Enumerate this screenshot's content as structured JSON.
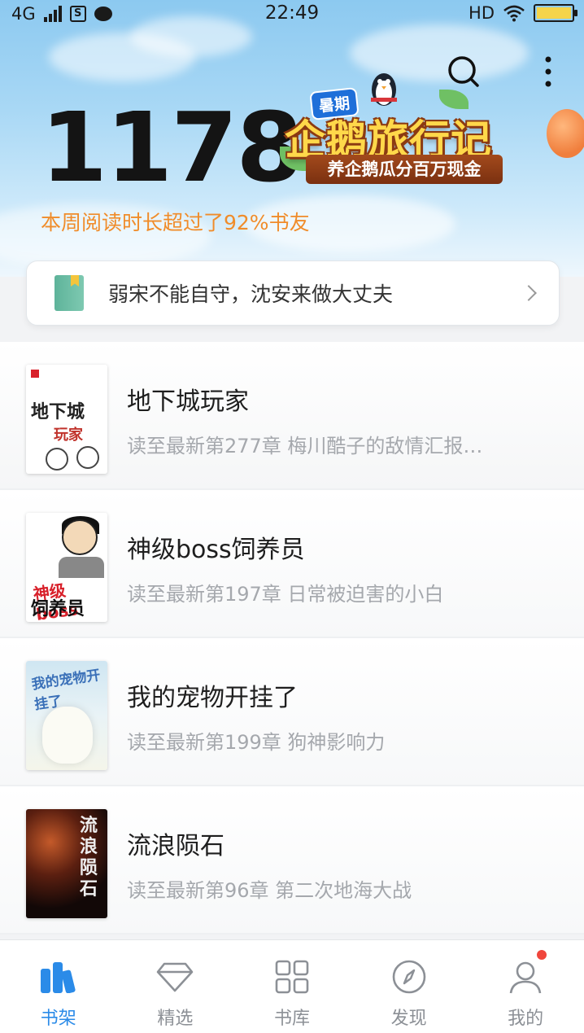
{
  "status_bar": {
    "network": "4G",
    "time": "22:49",
    "hd": "HD"
  },
  "header": {
    "reading_minutes": "1178",
    "subtitle": "本周阅读时长超过了92%书友",
    "banner": {
      "tag": "暑期",
      "title": "企鹅旅行记",
      "slogan": "养企鹅瓜分百万现金"
    }
  },
  "last_read": {
    "text": "弱宋不能自守，沈安来做大丈夫"
  },
  "books": [
    {
      "title": "地下城玩家",
      "progress": "读至最新第277章 梅川酷子的敌情汇报…",
      "cover_text_1": "地下城",
      "cover_text_2": "玩家"
    },
    {
      "title": "神级boss饲养员",
      "progress": "读至最新第197章 日常被迫害的小白",
      "cover_text_1": "神级boss",
      "cover_text_2": "饲养员"
    },
    {
      "title": "我的宠物开挂了",
      "progress": "读至最新第199章 狗神影响力",
      "cover_text_1": "我的宠物开挂了"
    },
    {
      "title": "流浪陨石",
      "progress": "读至最新第96章 第二次地海大战",
      "cover_text_1": "流浪陨石"
    }
  ],
  "tabs": [
    {
      "label": "书架",
      "icon": "bookshelf-icon",
      "active": true
    },
    {
      "label": "精选",
      "icon": "diamond-icon",
      "active": false
    },
    {
      "label": "书库",
      "icon": "grid-icon",
      "active": false
    },
    {
      "label": "发现",
      "icon": "compass-icon",
      "active": false
    },
    {
      "label": "我的",
      "icon": "user-icon",
      "active": false,
      "badge": true
    }
  ],
  "colors": {
    "accent": "#2b8be8",
    "subtitle_orange": "#f08c2a",
    "badge_red": "#f0463c"
  }
}
